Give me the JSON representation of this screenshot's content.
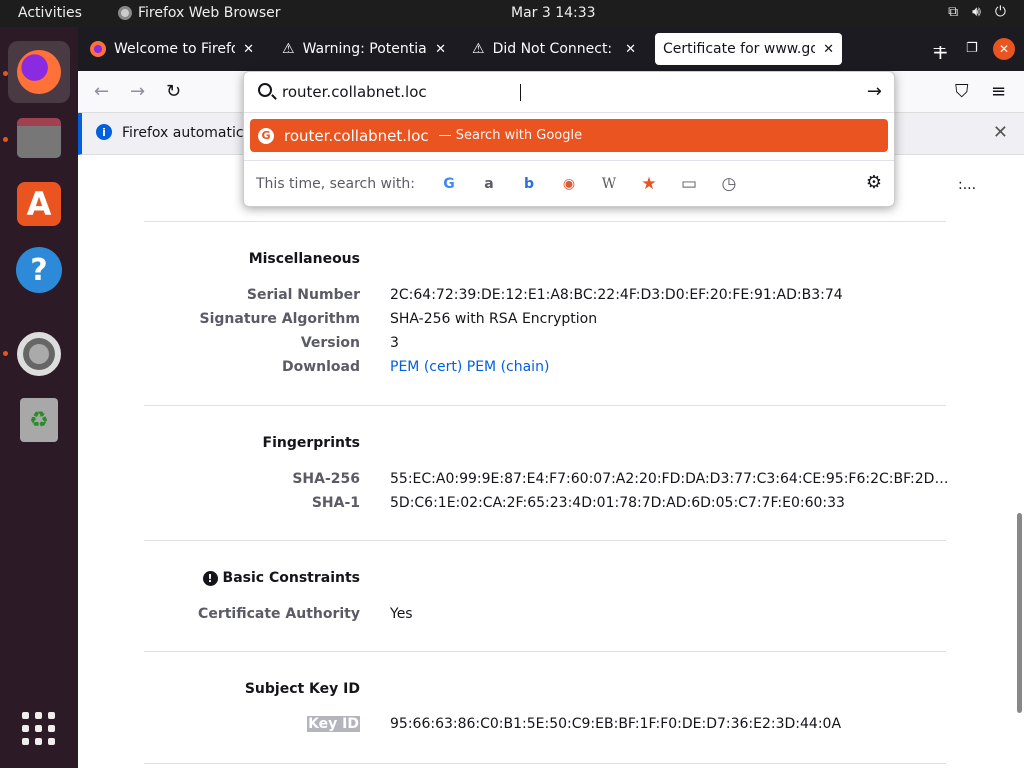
{
  "topbar": {
    "activities": "Activities",
    "app_name": "Firefox Web Browser",
    "clock": "Mar 3  14:33",
    "tray_icons": [
      "network-icon",
      "volume-icon",
      "power-icon"
    ]
  },
  "dock": {
    "items": [
      "firefox",
      "files",
      "software",
      "help",
      "settings",
      "trash"
    ],
    "store_glyph": "A",
    "help_glyph": "?",
    "trash_glyph": "♻"
  },
  "tabs": [
    {
      "title": "Welcome to Firefox",
      "icon": "firefox-icon"
    },
    {
      "title": "Warning: Potential S",
      "icon": "warning-icon"
    },
    {
      "title": "Did Not Connect: Po",
      "icon": "warning-icon"
    },
    {
      "title": "Certificate for www.go",
      "icon": "none"
    }
  ],
  "infobar": {
    "message": "Firefox automatica",
    "icon": "i"
  },
  "urlbar": {
    "value": "router.collabnet.loc",
    "suggestion_text": "router.collabnet.loc",
    "suggestion_sub": "— Search with Google",
    "search_with_label": "This time, search with:",
    "engines": [
      {
        "name": "google",
        "glyph": "G",
        "color": "#4285f4"
      },
      {
        "name": "amazon",
        "glyph": "a",
        "color": "#15141a"
      },
      {
        "name": "bing",
        "glyph": "b",
        "color": "#2c6fd6"
      },
      {
        "name": "duckduckgo",
        "glyph": "◉",
        "color": "#de5833"
      },
      {
        "name": "wikipedia",
        "glyph": "W",
        "color": "#15141a"
      },
      {
        "name": "bookmarks",
        "glyph": "★",
        "color": "#e95420"
      },
      {
        "name": "tabs",
        "glyph": "▭",
        "color": "#15141a"
      },
      {
        "name": "history",
        "glyph": "◷",
        "color": "#15141a"
      }
    ]
  },
  "page": {
    "top_ellipsis": ":...",
    "sections": {
      "misc": {
        "title": "Miscellaneous",
        "serial_label": "Serial Number",
        "serial_value": "2C:64:72:39:DE:12:E1:A8:BC:22:4F:D3:D0:EF:20:FE:91:AD:B3:74",
        "sigalg_label": "Signature Algorithm",
        "sigalg_value": "SHA-256 with RSA Encryption",
        "version_label": "Version",
        "version_value": "3",
        "download_label": "Download",
        "pem_cert": "PEM (cert)",
        "pem_chain": "PEM (chain)"
      },
      "fingerprints": {
        "title": "Fingerprints",
        "sha256_label": "SHA-256",
        "sha256_value": "55:EC:A0:99:9E:87:E4:F7:60:07:A2:20:FD:DA:D3:77:C3:64:CE:95:F6:2C:BF:2D…",
        "sha1_label": "SHA-1",
        "sha1_value": "5D:C6:1E:02:CA:2F:65:23:4D:01:78:7D:AD:6D:05:C7:7F:E0:60:33"
      },
      "basic": {
        "title": "Basic Constraints",
        "ca_label": "Certificate Authority",
        "ca_value": "Yes"
      },
      "skid": {
        "title": "Subject Key ID",
        "keyid_label": "Key ID",
        "keyid_value": "95:66:63:86:C0:B1:5E:50:C9:EB:BF:1F:F0:DE:D7:36:E2:3D:44:0A"
      }
    }
  }
}
